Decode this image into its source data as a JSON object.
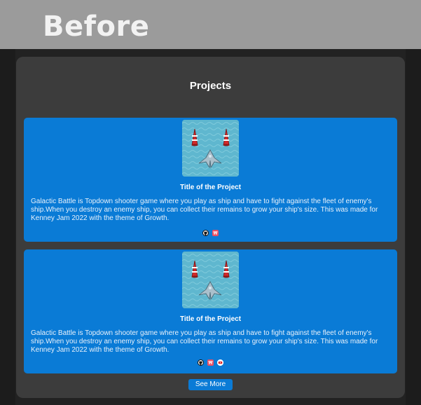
{
  "banner": {
    "title": "Before"
  },
  "section": {
    "heading": "Projects"
  },
  "projects": [
    {
      "title": "Title of the Project",
      "description": "Galactic Battle is Topdown shooter game where you play as ship and have to fight against the fleet of enemy's ship.When you destroy an enemy ship, you can collect their remains to grow your ship's size. This was made for Kenney Jam 2022 with the theme of Growth.",
      "thumbnail": "galactic-battle-thumbnail",
      "links": [
        "github-icon",
        "itch-icon"
      ]
    },
    {
      "title": "Title of the Project",
      "description": "Galactic Battle is Topdown shooter game where you play as ship and have to fight against the fleet of enemy's ship.When you destroy an enemy ship, you can collect their remains to grow your ship's size. This was made for Kenney Jam 2022 with the theme of Growth.",
      "thumbnail": "galactic-battle-thumbnail",
      "links": [
        "github-icon",
        "itch-icon",
        "youtube-icon"
      ]
    }
  ],
  "actions": {
    "see_more_label": "See More"
  },
  "colors": {
    "banner": "#9b9b9b",
    "panel": "#3c3c3c",
    "card": "#0a7bd6",
    "page_background": "#222222"
  }
}
